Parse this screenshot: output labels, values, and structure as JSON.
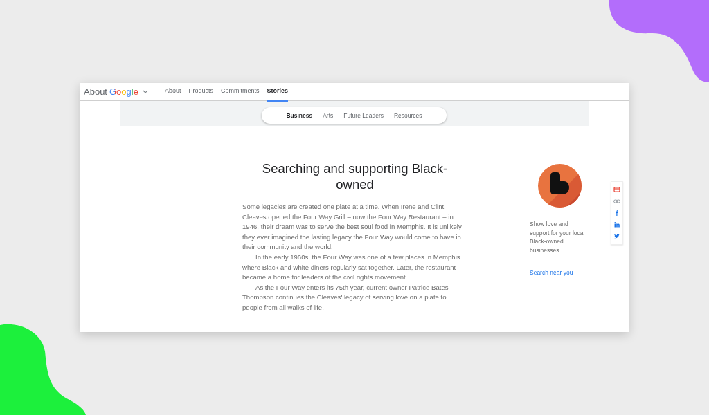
{
  "header": {
    "logo_prefix": "About",
    "logo_brand": "Google",
    "nav": [
      {
        "label": "About",
        "selected": false
      },
      {
        "label": "Products",
        "selected": false
      },
      {
        "label": "Commitments",
        "selected": false
      },
      {
        "label": "Stories",
        "selected": true
      }
    ]
  },
  "hero": {
    "tabs": [
      {
        "label": "Business",
        "selected": true
      },
      {
        "label": "Arts",
        "selected": false
      },
      {
        "label": "Future Leaders",
        "selected": false
      },
      {
        "label": "Resources",
        "selected": false
      }
    ]
  },
  "article": {
    "title": "Searching and supporting Black-owned",
    "paragraphs": [
      "Some legacies are created one plate at a time. When Irene and Clint Cleaves opened the Four Way Grill – now the Four Way Restaurant – in 1946, their dream was to serve the best soul food in Memphis. It is unlikely they ever imagined the lasting legacy the Four Way would come to have in their community and the world.",
      "In the early 1960s, the Four Way was one of a few places in Memphis where Black and white diners regularly sat together. Later, the restaurant became a home for leaders of the civil rights movement.",
      "As the Four Way enters its 75th year, current owner Patrice Bates Thompson continues the Cleaves' legacy of serving love on a plate to people from all walks of life."
    ]
  },
  "sidebar": {
    "text": "Show love and support for your local Black-owned businesses.",
    "link": "Search near you"
  },
  "share": [
    {
      "kind": "email"
    },
    {
      "kind": "link"
    },
    {
      "kind": "facebook"
    },
    {
      "kind": "linkedin"
    },
    {
      "kind": "twitter"
    }
  ]
}
